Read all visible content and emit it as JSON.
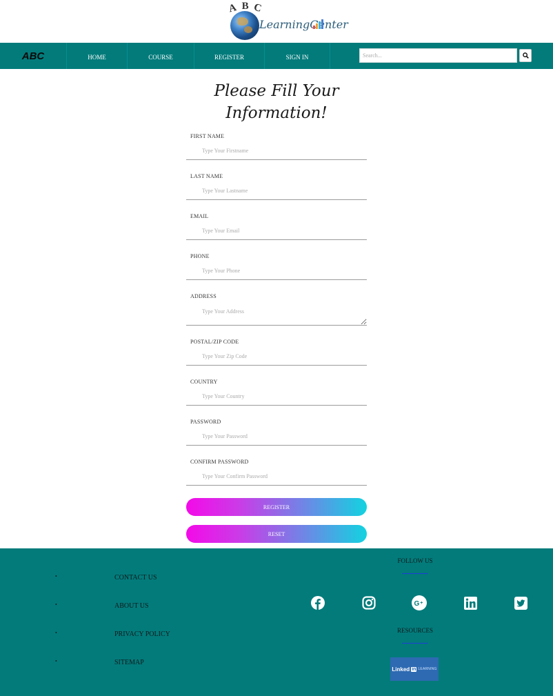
{
  "logo": {
    "letters": [
      "A",
      "B",
      "C"
    ],
    "wordmark": "LearningCenter"
  },
  "nav": {
    "brand": "ABC",
    "items": [
      "HOME",
      "COURSE",
      "REGISTER",
      "SIGN IN"
    ],
    "search_placeholder": "Search...",
    "search_icon": "search-icon"
  },
  "form": {
    "title_line1": "Please Fill Your",
    "title_line2": "Information!",
    "fields": [
      {
        "label": "FIRST NAME",
        "placeholder": "Type Your Firstname"
      },
      {
        "label": "LAST NAME",
        "placeholder": "Type Your Lastname"
      },
      {
        "label": "EMAIL",
        "placeholder": "Type Your Email"
      },
      {
        "label": "PHONE",
        "placeholder": "Type Your Phone"
      },
      {
        "label": "ADDRESS",
        "placeholder": "Type Your Address"
      },
      {
        "label": "POSTAL/ZIP CODE",
        "placeholder": "Type Your Zip Code"
      },
      {
        "label": "COUNTRY",
        "placeholder": "Type Your Country"
      },
      {
        "label": "PASSWORD",
        "placeholder": "Type Your Password"
      },
      {
        "label": "CONFIRM PASSWORD",
        "placeholder": "Type Your Confirm Password"
      }
    ],
    "register_label": "REGISTER",
    "reset_label": "RESET"
  },
  "footer": {
    "links": [
      "CONTACT US",
      "ABOUT US",
      "PRIVACY POLICY",
      "SITEMAP"
    ],
    "follow_heading": "FOLLOW US",
    "socials": [
      "facebook-icon",
      "instagram-icon",
      "google-plus-icon",
      "linkedin-icon",
      "twitter-icon"
    ],
    "resources_heading": "RESOURCES",
    "linkedin_badge": {
      "word": "Linked",
      "in": "in",
      "learning": "LEARNING"
    }
  },
  "colors": {
    "teal": "#037b7b",
    "gradient_start": "#f40ae8",
    "gradient_end": "#12d3e0",
    "rule": "#1c3fd6"
  }
}
